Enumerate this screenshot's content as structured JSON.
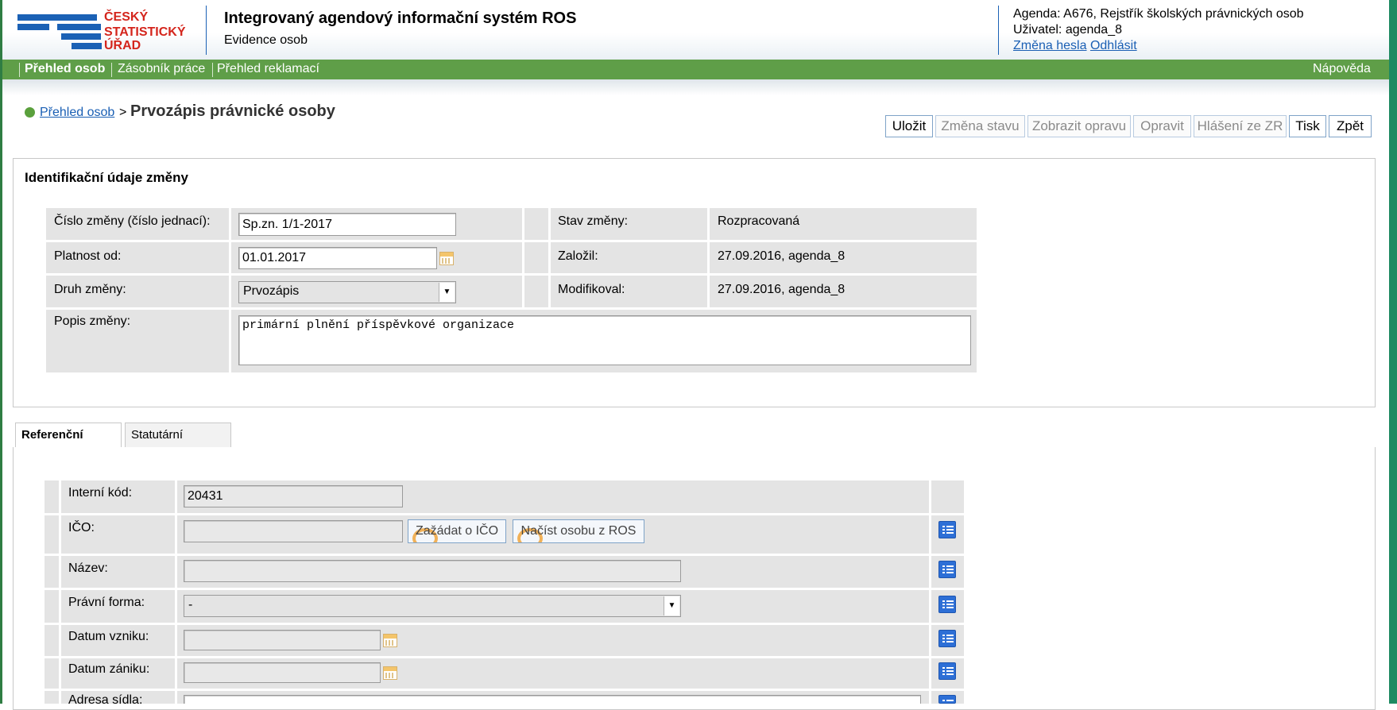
{
  "logo": {
    "line1": "ČESKÝ",
    "line2": "STATISTICKÝ",
    "line3": "ÚŘAD"
  },
  "header": {
    "title": "Integrovaný agendový informační systém ROS",
    "subtitle": "Evidence osob",
    "agenda_label": "Agenda:",
    "agenda_value": "A676, Rejstřík školských právnických osob",
    "user_label": "Uživatel:",
    "user_value": "agenda_8",
    "change_password": "Změna hesla",
    "logout": "Odhlásit"
  },
  "nav": {
    "items": [
      "Přehled osob",
      "Zásobník práce",
      "Přehled reklamací"
    ],
    "help": "Nápověda"
  },
  "breadcrumb": {
    "link": "Přehled osob",
    "separator": ">",
    "current": "Prvozápis právnické osoby"
  },
  "toolbar": {
    "buttons": [
      "Uložit",
      "Změna stavu",
      "Zobrazit opravu",
      "Opravit",
      "Hlášení ze ZR",
      "Tisk",
      "Zpět"
    ]
  },
  "identification": {
    "title": "Identifikační údaje změny",
    "cislo_label": "Číslo změny (číslo jednací):",
    "cislo_value": "Sp.zn. 1/1-2017",
    "platnost_label": "Platnost od:",
    "platnost_value": "01.01.2017",
    "druh_label": "Druh změny:",
    "druh_value": "Prvozápis",
    "popis_label": "Popis změny:",
    "popis_value": "primární plnění příspěvkové organizace",
    "stav_label": "Stav změny:",
    "stav_value": "Rozpracovaná",
    "zalozil_label": "Založil:",
    "zalozil_value": "27.09.2016, agenda_8",
    "modifikoval_label": "Modifikoval:",
    "modifikoval_value": "27.09.2016, agenda_8"
  },
  "tabs": [
    "Referenční údaje",
    "Statutární zástupci"
  ],
  "reference": {
    "interni_kod_label": "Interní kód:",
    "interni_kod_value": "20431",
    "ico_label": "IČO:",
    "ico_value": "",
    "request_ico_button": "Zažádat o IČO",
    "load_person_button": "Načíst osobu z ROS",
    "nazev_label": "Název:",
    "nazev_value": "",
    "pravni_forma_label": "Právní forma:",
    "pravni_forma_value": "-",
    "datum_vzniku_label": "Datum vzniku:",
    "datum_zaniku_label": "Datum zániku:",
    "adresa_label": "Adresa sídla:"
  }
}
